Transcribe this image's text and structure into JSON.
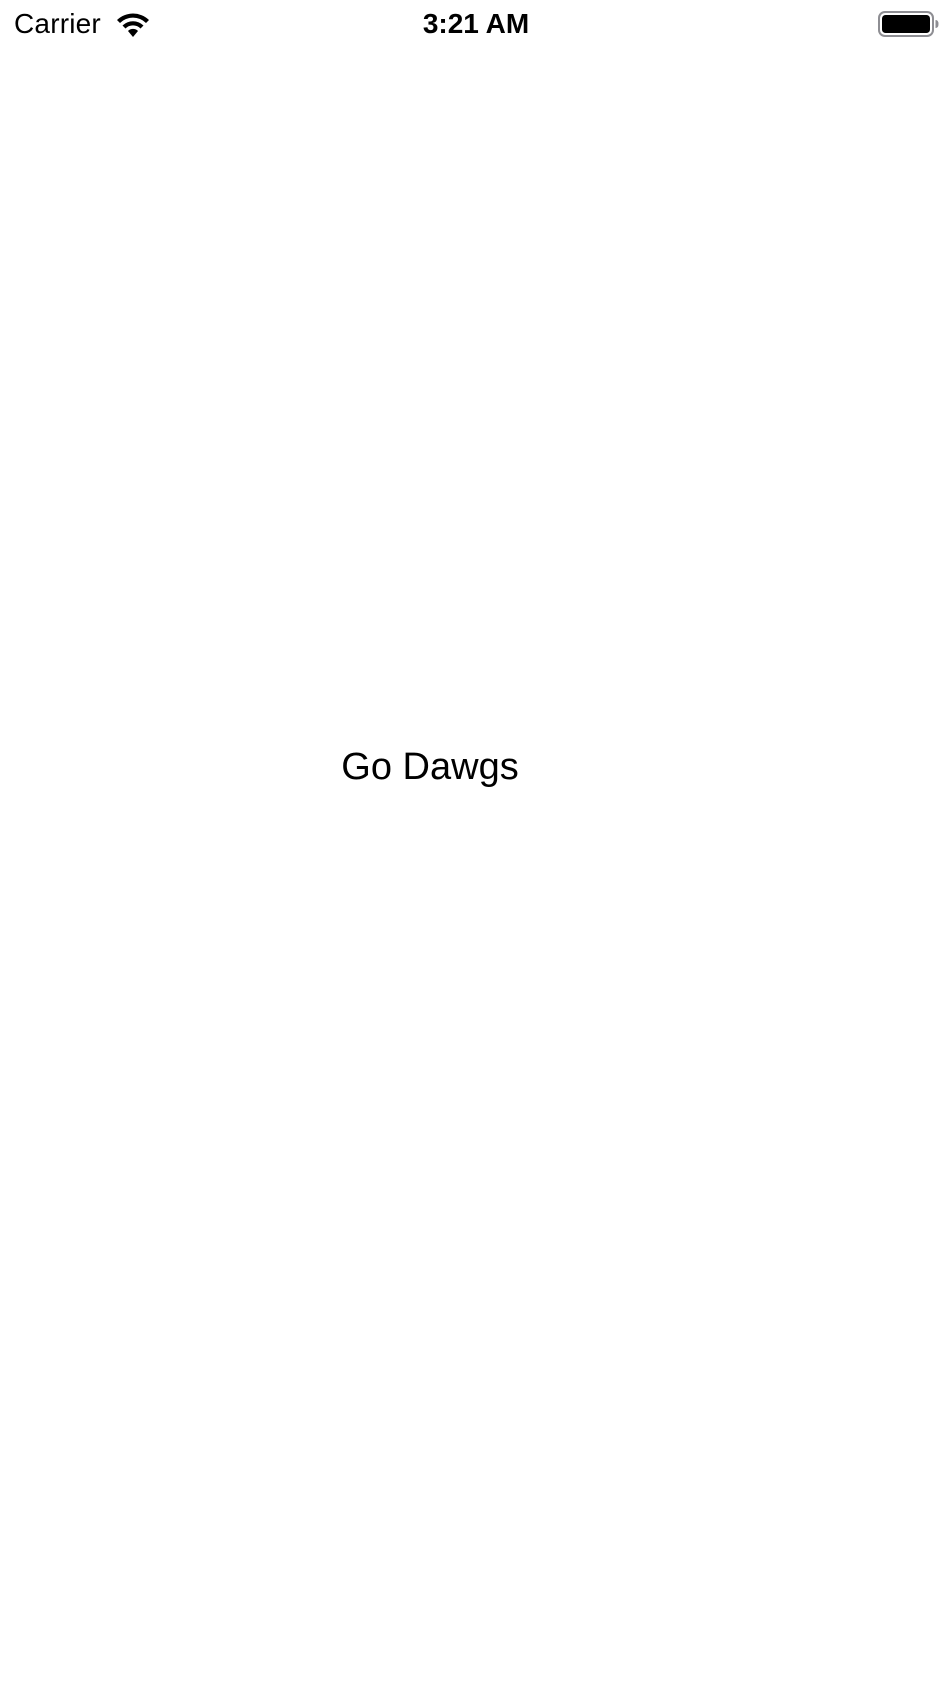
{
  "status_bar": {
    "carrier": "Carrier",
    "time": "3:21 AM",
    "icons": {
      "wifi": "wifi-icon",
      "battery": "battery-icon"
    },
    "battery_level": 1.0
  },
  "main": {
    "label": "Go Dawgs"
  },
  "colors": {
    "background": "#ffffff",
    "text": "#000000"
  }
}
